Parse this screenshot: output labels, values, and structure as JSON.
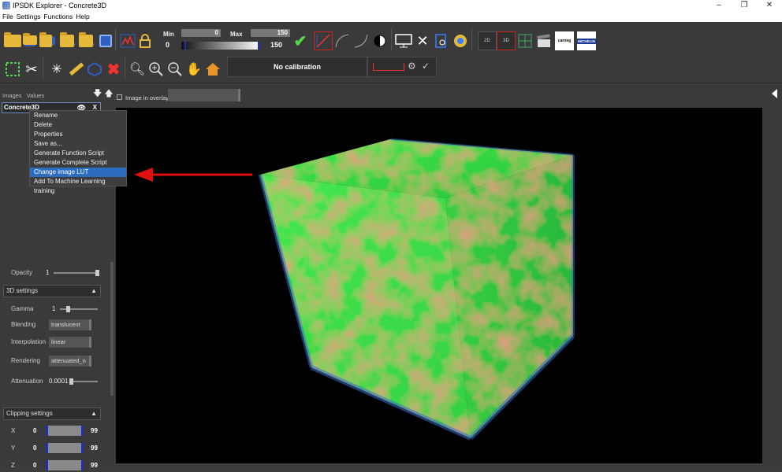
{
  "window": {
    "title": "IPSDK Explorer - Concrete3D",
    "controls": [
      "–",
      "❐",
      "✕"
    ]
  },
  "menu": [
    "File",
    "Settings",
    "Functions",
    "Help"
  ],
  "toolbar": {
    "min_label": "Min",
    "min_field": "0",
    "min_value": "0",
    "max_label": "Max",
    "max_field": "150",
    "max_value": "150",
    "calibration": "No calibration",
    "view_2d": "2D",
    "view_3d": "3D",
    "raw_label": "raw",
    "carnegie_label": "carneg",
    "michelin_label": "MICHELIN"
  },
  "left_panel": {
    "tabs": [
      "Images",
      "Values"
    ],
    "image_name": "Concrete3D",
    "context_menu": [
      "Rename",
      "Delete",
      "Properties",
      "Save as...",
      "Generate Function Script",
      "Generate Complete Script",
      "Change image LUT",
      "Add To Machine Learning training"
    ],
    "context_menu_active_index": 6
  },
  "settings": {
    "opacity_label": "Opacity",
    "opacity_value": "1",
    "section_3d": "3D settings",
    "gamma_label": "Gamma",
    "gamma_value": "1",
    "blending_label": "Blending",
    "blending_value": "translucent",
    "interpolation_label": "Interpolation",
    "interpolation_value": "linear",
    "rendering_label": "Rendering",
    "rendering_value": "attenuated_n",
    "attenuation_label": "Attenuation",
    "attenuation_value": "0.0001",
    "section_clipping": "Clipping settings",
    "clipping": [
      {
        "axis": "X",
        "min": "0",
        "max": "99"
      },
      {
        "axis": "Y",
        "min": "0",
        "max": "99"
      },
      {
        "axis": "Z",
        "min": "0",
        "max": "99"
      }
    ]
  },
  "overlay": {
    "label": "Image in overlay"
  },
  "colors": {
    "accent": "#2d6dbd",
    "arrow": "#e01010",
    "lut_green": "#3de84a",
    "lut_red": "#c8503a",
    "lut_blue": "#3a6cc8"
  }
}
